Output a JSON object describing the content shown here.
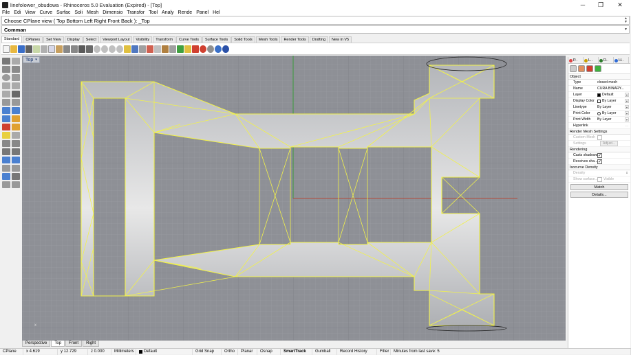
{
  "window": {
    "title": "linefolower_obudowa - Rhinoceros 5.0 Evaluation (Expired) - [Top]",
    "minimize": "─",
    "maximize": "❐",
    "close": "✕"
  },
  "menu": [
    "File",
    "Edi",
    "View",
    "Curve",
    "Surfac",
    "Soli",
    "Mesh",
    "Dimensio",
    "Transfor",
    "Tool",
    "Analy",
    "Rende",
    "Panel",
    "Hel"
  ],
  "command": {
    "history": "Choose CPlane view ( Top  Bottom  Left  Right  Front  Back ): _Top",
    "prompt": "Comman"
  },
  "toolbar_tabs": [
    "Standard",
    "CPlanes",
    "Set View",
    "Display",
    "Select",
    "Viewport Layout",
    "Visibility",
    "Transform",
    "Curve Tools",
    "Surface Tools",
    "Solid Tools",
    "Mesh Tools",
    "Render Tools",
    "Drafting",
    "New in V5"
  ],
  "viewport": {
    "label": "Top",
    "dropdown": "▾",
    "axis_label": "x"
  },
  "viewport_tabs": [
    "Perspective",
    "Top",
    "Front",
    "Right"
  ],
  "status": {
    "cplane": "CPlane",
    "x": "x 4.619",
    "y": "y 12.729",
    "z": "z 0.000",
    "units": "Millimeters",
    "layer": "Default",
    "grid_snap": "Grid Snap",
    "ortho": "Ortho",
    "planar": "Planar",
    "osnap": "Osnap",
    "smarttrack": "SmartTrack",
    "gumball": "Gumball",
    "record_history": "Record History",
    "filter": "Filter",
    "minutes": "Minutes from last save: 5"
  },
  "panel": {
    "tabs": [
      {
        "label": "P..",
        "color": "#d44"
      },
      {
        "label": "L..",
        "color": "#c8a000"
      },
      {
        "label": "D..",
        "color": "#2a7a2a"
      },
      {
        "label": "H..",
        "color": "#2e6ad6"
      }
    ],
    "section_object": "Object",
    "rows": [
      {
        "key": "Type",
        "value": "closed mesh"
      },
      {
        "key": "Name",
        "value": "CURA BINARY..."
      },
      {
        "key": "Layer",
        "value": "Default"
      },
      {
        "key": "Display Color",
        "value": "By Layer"
      },
      {
        "key": "Linetype",
        "value": "By Layer"
      },
      {
        "key": "Print Color",
        "value": "By Layer"
      },
      {
        "key": "Print Width",
        "value": "By Layer"
      },
      {
        "key": "Hyperlink",
        "value": ""
      }
    ],
    "section_render_mesh": "Render Mesh Settings",
    "custom_mesh": "Custom Mesh",
    "settings": "Settings",
    "adjust": "Adjust...",
    "section_rendering": "Rendering",
    "casts_shadows": "Casts shadows",
    "receives_shadows": "Receives sha...",
    "section_isocurve": "Isocurve Density",
    "density": "Density",
    "show_surface": "Show surface...",
    "visible": "Visible",
    "match": "Match",
    "details": "Details..."
  },
  "colors": {
    "viewport_bg": "#8e9096",
    "grid_minor": "#9da0a6",
    "grid_major": "#7c7f85",
    "mesh_edge": "#f2f24a",
    "mesh_fill": "#cfd0d2",
    "x_axis": "#b44a3a",
    "y_axis": "#3a9a3a"
  }
}
